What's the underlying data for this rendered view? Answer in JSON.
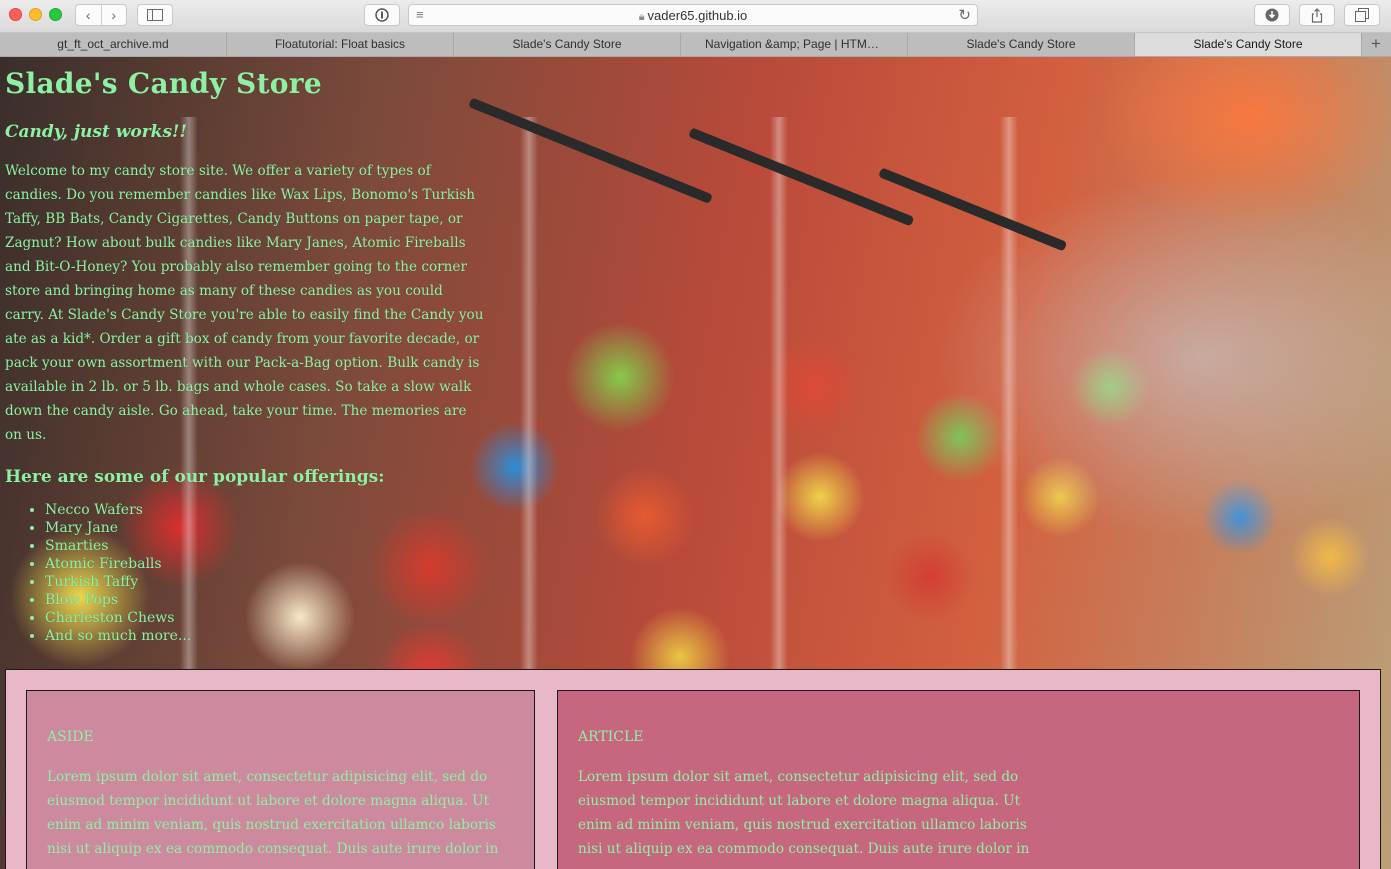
{
  "browser": {
    "url": "vader65.github.io",
    "tabs": [
      {
        "label": "gt_ft_oct_archive.md",
        "active": false
      },
      {
        "label": "Floatutorial: Float basics",
        "active": false
      },
      {
        "label": "Slade's Candy Store",
        "active": false
      },
      {
        "label": "Navigation &amp; Page | HTML, C...",
        "active": false
      },
      {
        "label": "Slade's Candy Store",
        "active": false
      },
      {
        "label": "Slade's Candy Store",
        "active": true
      }
    ]
  },
  "page": {
    "title": "Slade's Candy Store",
    "tagline": "Candy, just works!!",
    "intro": "Welcome to my candy store site. We offer a variety of types of candies. Do you remember candies like Wax Lips, Bonomo's Turkish Taffy, BB Bats, Candy Cigarettes, Candy Buttons on paper tape, or Zagnut? How about bulk candies like Mary Janes, Atomic Fireballs and Bit-O-Honey? You probably also remember going to the corner store and bringing home as many of these candies as you could carry. At Slade's Candy Store you're able to easily find the Candy you ate as a kid*. Order a gift box of candy from your favorite decade, or pack your own assortment with our Pack-a-Bag option. Bulk candy is available in 2 lb. or 5 lb. bags and whole cases. So take a slow walk down the candy aisle. Go ahead, take your time. The memories are on us.",
    "offerings_heading": "Here are some of our popular offerings:",
    "offerings": [
      "Necco Wafers",
      "Mary Jane",
      "Smarties",
      "Atomic Fireballs",
      "Turkish Taffy",
      "Blow Pops",
      "Charleston Chews",
      "And so much more..."
    ],
    "aside": {
      "heading": "ASIDE",
      "text": "Lorem ipsum dolor sit amet, consectetur adipisicing elit, sed do eiusmod tempor incididunt ut labore et dolore magna aliqua. Ut enim ad minim veniam, quis nostrud exercitation ullamco laboris nisi ut aliquip ex ea commodo consequat. Duis aute irure dolor in"
    },
    "article": {
      "heading": "ARTICLE",
      "text": "Lorem ipsum dolor sit amet, consectetur adipisicing elit, sed do eiusmod tempor incididunt ut labore et dolore magna aliqua. Ut enim ad minim veniam, quis nostrud exercitation ullamco laboris nisi ut aliquip ex ea commodo consequat. Duis aute irure dolor in"
    }
  },
  "colors": {
    "text_green": "#8ff0a4",
    "bottom_pink": "#e9b8c8",
    "aside_pink": "#cd8a9e",
    "article_pink": "#c6677f"
  },
  "icons": [
    "close-dot-icon",
    "minimize-dot-icon",
    "zoom-dot-icon",
    "back-icon",
    "forward-icon",
    "sidebar-icon",
    "privacy-report-icon",
    "reader-icon",
    "lock-icon",
    "reload-icon",
    "download-icon",
    "share-icon",
    "tab-overview-icon",
    "new-tab-icon"
  ]
}
